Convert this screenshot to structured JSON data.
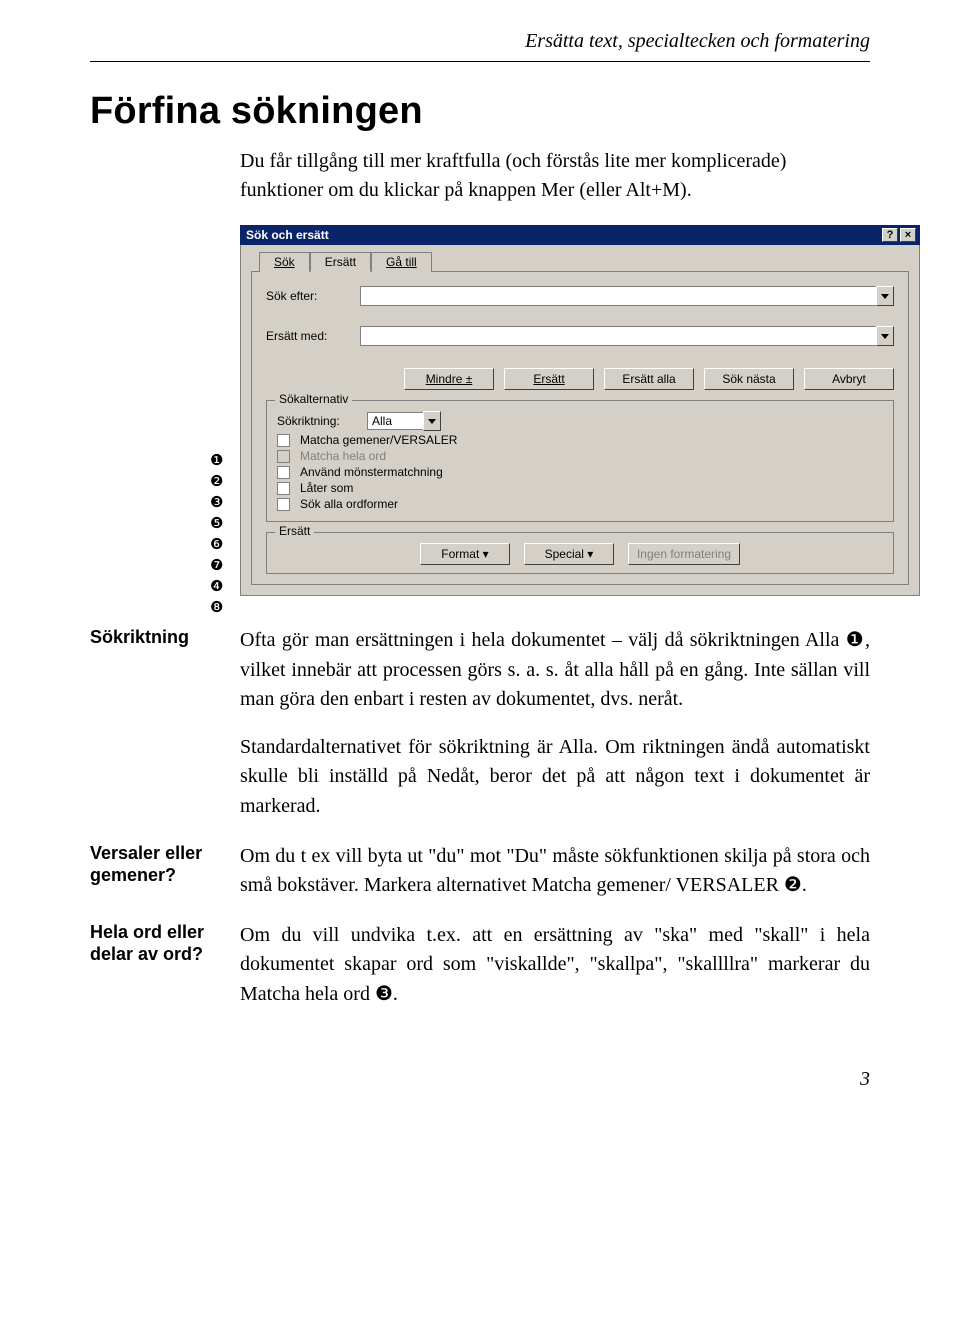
{
  "running_head": "Ersätta text, specialtecken och formatering",
  "heading": "Förfina sökningen",
  "intro": "Du får tillgång till mer kraftfulla (och förstås lite mer komplicerade) funktioner om du klickar på knappen Mer (eller Alt+M).",
  "dialog": {
    "title": "Sök och ersätt",
    "help_btn": "?",
    "close_btn": "×",
    "tabs": {
      "sok": "Sök",
      "ersatt": "Ersätt",
      "gatill": "Gå till"
    },
    "find_label": "Sök efter:",
    "find_value": "",
    "replace_label": "Ersätt med:",
    "replace_value": "",
    "buttons": {
      "mindre": "Mindre  ±",
      "ersatt": "Ersätt",
      "ersatt_alla": "Ersätt alla",
      "sok_nasta": "Sök nästa",
      "avbryt": "Avbryt"
    },
    "options_legend": "Sökalternativ",
    "direction_label": "Sökriktning:",
    "direction_value": "Alla",
    "checks": {
      "case": "Matcha gemener/VERSALER",
      "whole": "Matcha hela ord",
      "pattern": "Använd mönstermatchning",
      "sounds": "Låter som",
      "forms": "Sök alla ordformer"
    },
    "replace_legend": "Ersätt",
    "bottom": {
      "format": "Format  ▾",
      "special": "Special  ▾",
      "noformat": "Ingen formatering"
    }
  },
  "callouts": [
    "❶",
    "❷",
    "❸",
    "❺",
    "❻",
    "❼",
    "❹",
    "❽"
  ],
  "sections": {
    "sokriktning": {
      "label": "Sökriktning",
      "p1": "Ofta gör man ersättningen i hela dokumentet – välj då sökriktningen Alla ❶, vilket innebär att processen görs s. a. s. åt alla håll på en gång. Inte sällan vill man göra den enbart i resten av dokumentet, dvs. neråt.",
      "p2": "Standardalternativet för sökriktning är Alla. Om riktningen ändå automatiskt skulle bli inställd på Nedåt, beror det på att någon text i dokumentet är markerad."
    },
    "versaler": {
      "label": "Versaler eller gemener?",
      "p1": "Om du t ex vill byta ut \"du\" mot \"Du\" måste sökfunktionen skilja på stora och små bokstäver. Markera alternativet Matcha gemener/ VERSALER ❷."
    },
    "helaord": {
      "label": "Hela ord eller delar av ord?",
      "p1": "Om du vill undvika t.ex. att en ersättning av \"ska\" med \"skall\" i hela dokumentet skapar ord som \"viskallde\", \"skallpa\", \"skallllra\" markerar du Matcha hela ord ❸."
    }
  },
  "page_number": "3"
}
